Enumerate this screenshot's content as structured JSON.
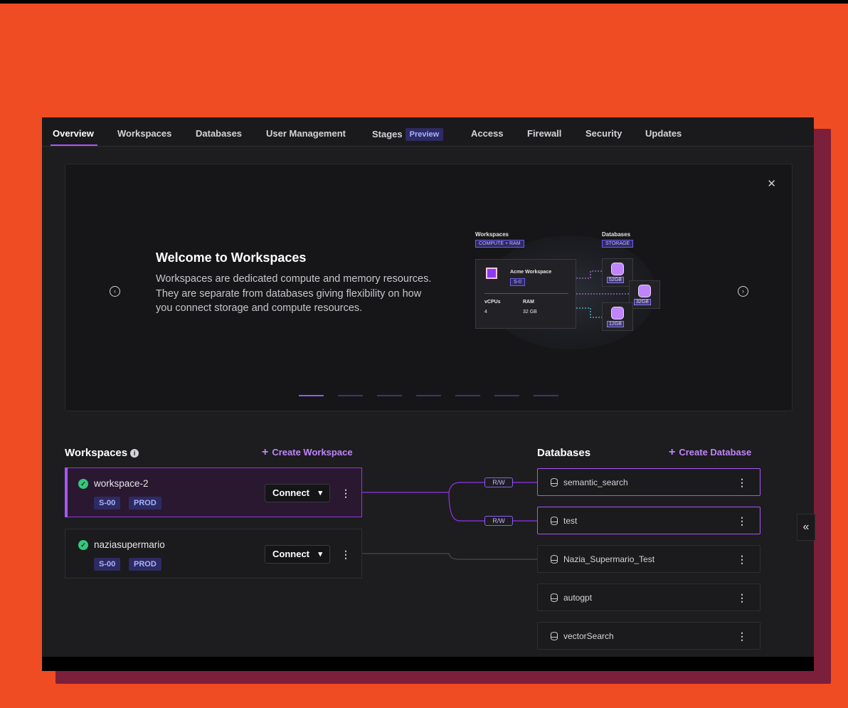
{
  "tabs": [
    {
      "label": "Overview"
    },
    {
      "label": "Workspaces"
    },
    {
      "label": "Databases"
    },
    {
      "label": "User Management"
    },
    {
      "label": "Stages",
      "badge": "Preview"
    },
    {
      "label": "Access"
    },
    {
      "label": "Firewall"
    },
    {
      "label": "Security"
    },
    {
      "label": "Updates"
    }
  ],
  "carousel": {
    "close_icon": "close-icon",
    "title": "Welcome to Workspaces",
    "body": "Workspaces are dedicated compute and memory resources. They are separate from databases giving flexibility on how you connect storage and compute resources.",
    "slide_count": 7,
    "active_slide": 1,
    "illustration": {
      "workspaces_label": "Workspaces",
      "workspaces_tag": "COMPUTE + RAM",
      "databases_label": "Databases",
      "databases_tag": "STORAGE",
      "card_name": "Acme Workspace",
      "card_size": "S-0",
      "vcpus_label": "vCPUs",
      "vcpus_value": "4",
      "ram_label": "RAM",
      "ram_value": "32 GB",
      "db_sizes": [
        "52GB",
        "32GB",
        "12GB"
      ]
    }
  },
  "workspaces_section": {
    "title": "Workspaces",
    "create_label": "Create Workspace",
    "items": [
      {
        "name": "workspace-2",
        "size": "S-00",
        "env": "PROD",
        "connect_label": "Connect",
        "status": "running"
      },
      {
        "name": "naziasupermario",
        "size": "S-00",
        "env": "PROD",
        "connect_label": "Connect",
        "status": "running"
      }
    ]
  },
  "databases_section": {
    "title": "Databases",
    "create_label": "Create Database",
    "items": [
      {
        "name": "semantic_search",
        "linked": true
      },
      {
        "name": "test",
        "linked": true
      },
      {
        "name": "Nazia_Supermario_Test",
        "linked": false
      },
      {
        "name": "autogpt",
        "linked": false
      },
      {
        "name": "vectorSearch",
        "linked": false
      }
    ]
  },
  "connection_label": "R/W",
  "colors": {
    "background": "#f04c24",
    "accent": "#a855f7",
    "status_ok": "#34c77b",
    "badge_bg": "#2e2a63"
  }
}
